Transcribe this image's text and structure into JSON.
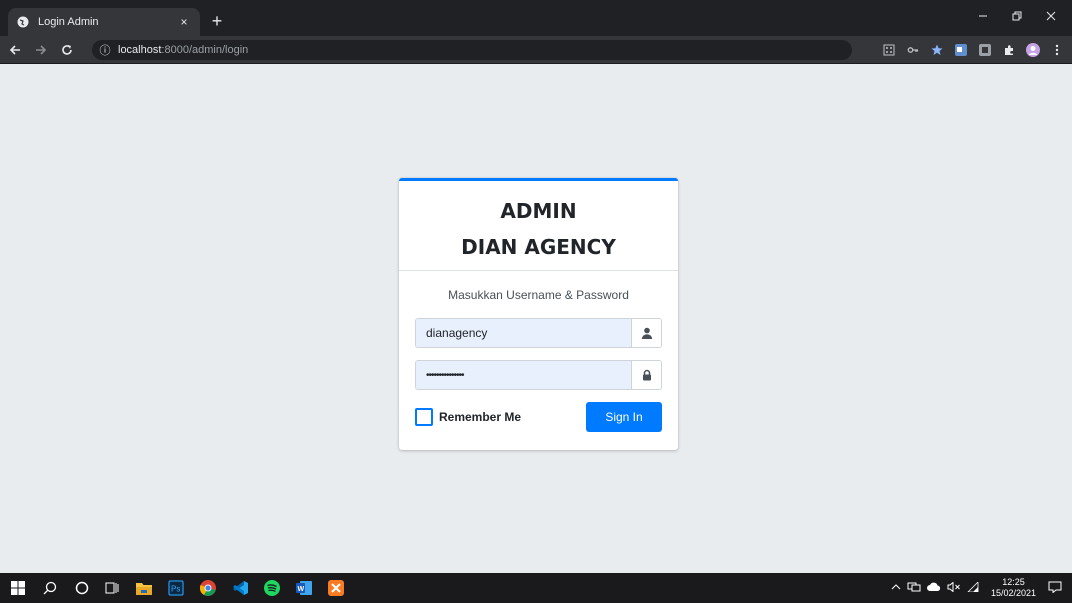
{
  "browser": {
    "tab_title": "Login Admin",
    "tab_close": "×",
    "new_tab": "+",
    "url_host": "localhost",
    "url_path": ":8000/admin/login",
    "info": "ⓘ"
  },
  "login": {
    "title_line1": "ADMIN",
    "title_line2": "DIAN AGENCY",
    "subtitle": "Masukkan Username & Password",
    "username_value": "dianagency",
    "password_value": "•••••••••••••••",
    "remember_label": "Remember Me",
    "sign_in_label": "Sign In"
  },
  "taskbar": {
    "time": "12:25",
    "date": "15/02/2021"
  },
  "colors": {
    "accent": "#007bff",
    "page_bg": "#e9ecef",
    "chrome_dark": "#202124"
  }
}
